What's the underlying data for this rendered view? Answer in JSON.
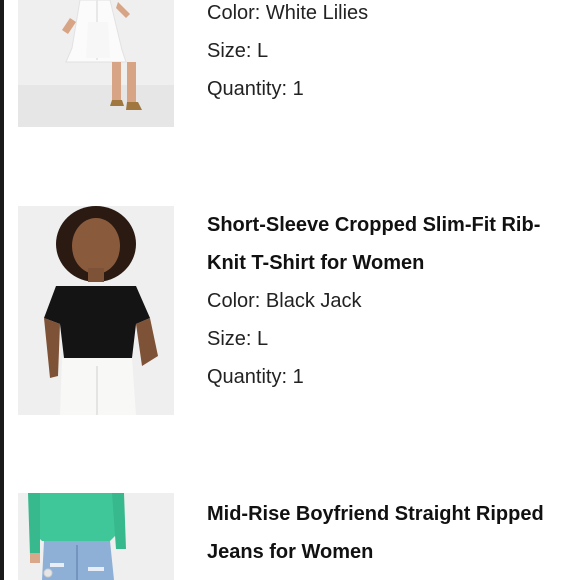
{
  "items": [
    {
      "title_lines": [],
      "color_label": "Color:",
      "color_value": "White Lilies",
      "size_label": "Size:",
      "size_value": "L",
      "quantity_label": "Quantity:",
      "quantity_value": "1",
      "image": "white-dress-photo"
    },
    {
      "title_lines": [
        "Short-Sleeve Cropped Slim-Fit Rib-",
        "Knit T-Shirt for Women"
      ],
      "color_label": "Color:",
      "color_value": "Black Jack",
      "size_label": "Size:",
      "size_value": "L",
      "quantity_label": "Quantity:",
      "quantity_value": "1",
      "image": "black-tshirt-photo"
    },
    {
      "title_lines": [
        "Mid-Rise Boyfriend Straight Ripped",
        "Jeans for Women"
      ],
      "image": "ripped-jeans-photo"
    }
  ],
  "colors": {
    "text": "#111111",
    "photo_bg": "#ececec",
    "divider": "#1a1a1a"
  }
}
